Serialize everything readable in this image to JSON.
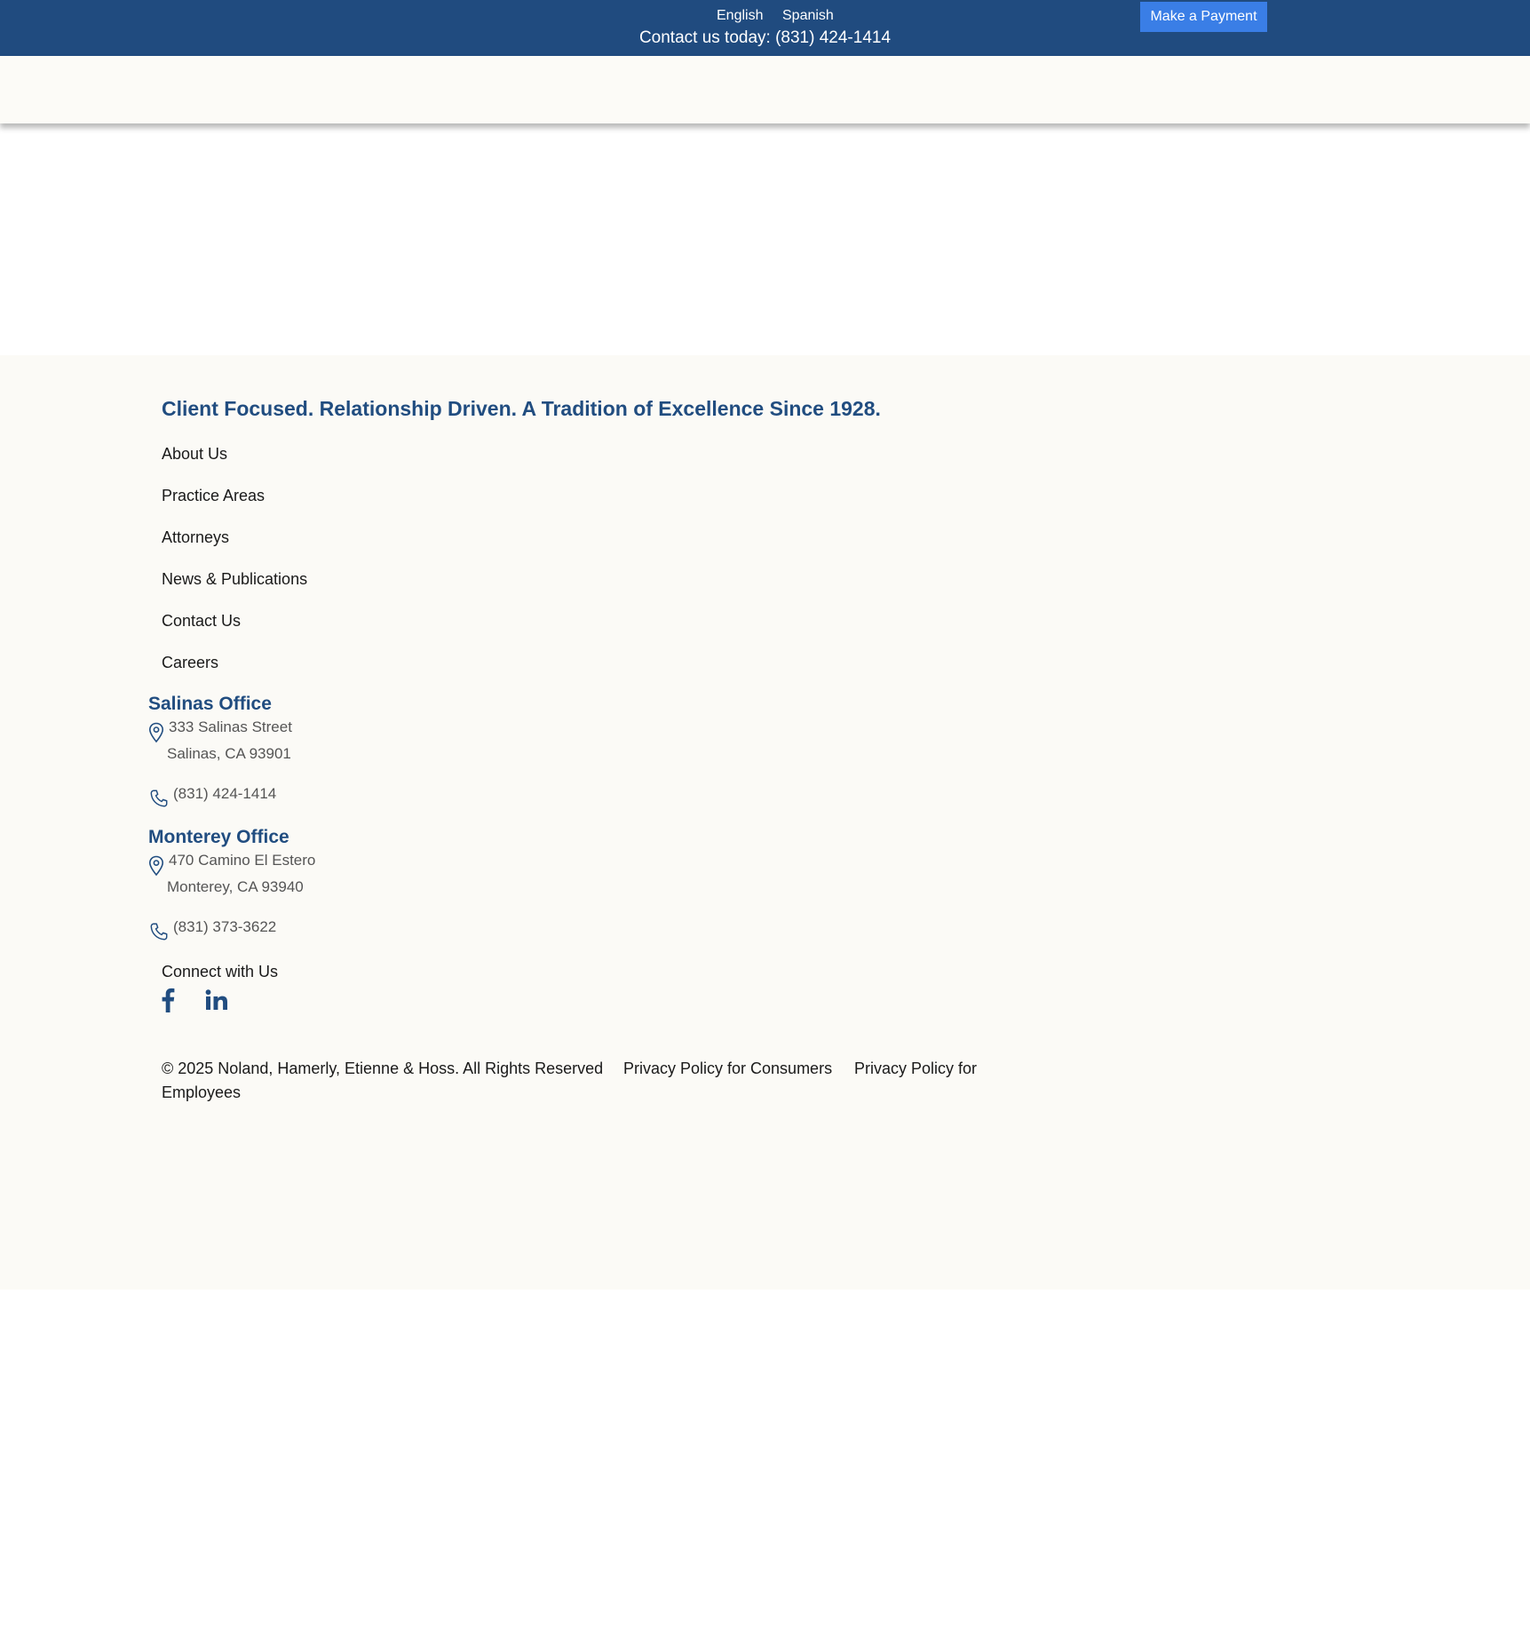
{
  "topbar": {
    "languages": [
      "English",
      "Spanish"
    ],
    "contact_text": "Contact us today: (831) 424-1414",
    "payment_button": "Make a Payment"
  },
  "footer": {
    "tagline": "Client Focused. Relationship Driven. A Tradition of Excellence Since 1928.",
    "nav_links": [
      "About Us",
      "Practice Areas",
      "Attorneys",
      "News & Publications",
      "Contact Us",
      "Careers"
    ],
    "offices": [
      {
        "title": "Salinas Office",
        "address_line1": "333 Salinas Street",
        "address_line2": "Salinas, CA 93901",
        "phone": "(831) 424-1414"
      },
      {
        "title": "Monterey Office",
        "address_line1": "470 Camino El Estero",
        "address_line2": "Monterey, CA 93940",
        "phone": "(831) 373-3622"
      }
    ],
    "connect_label": "Connect with Us",
    "social_icons": [
      "facebook-icon",
      "linkedin-icon"
    ],
    "copyright": "© 2025 Noland, Hamerly, Etienne & Hoss. All Rights Reserved",
    "privacy_consumers": "Privacy Policy for Consumers",
    "privacy_employees_line1": "Privacy Policy for",
    "privacy_employees_line2": "Employees"
  },
  "colors": {
    "topbar_bg": "#204b7f",
    "accent_blue": "#214d80",
    "button_bg": "#3a7ee6",
    "footer_bg": "#fbfaf6"
  }
}
